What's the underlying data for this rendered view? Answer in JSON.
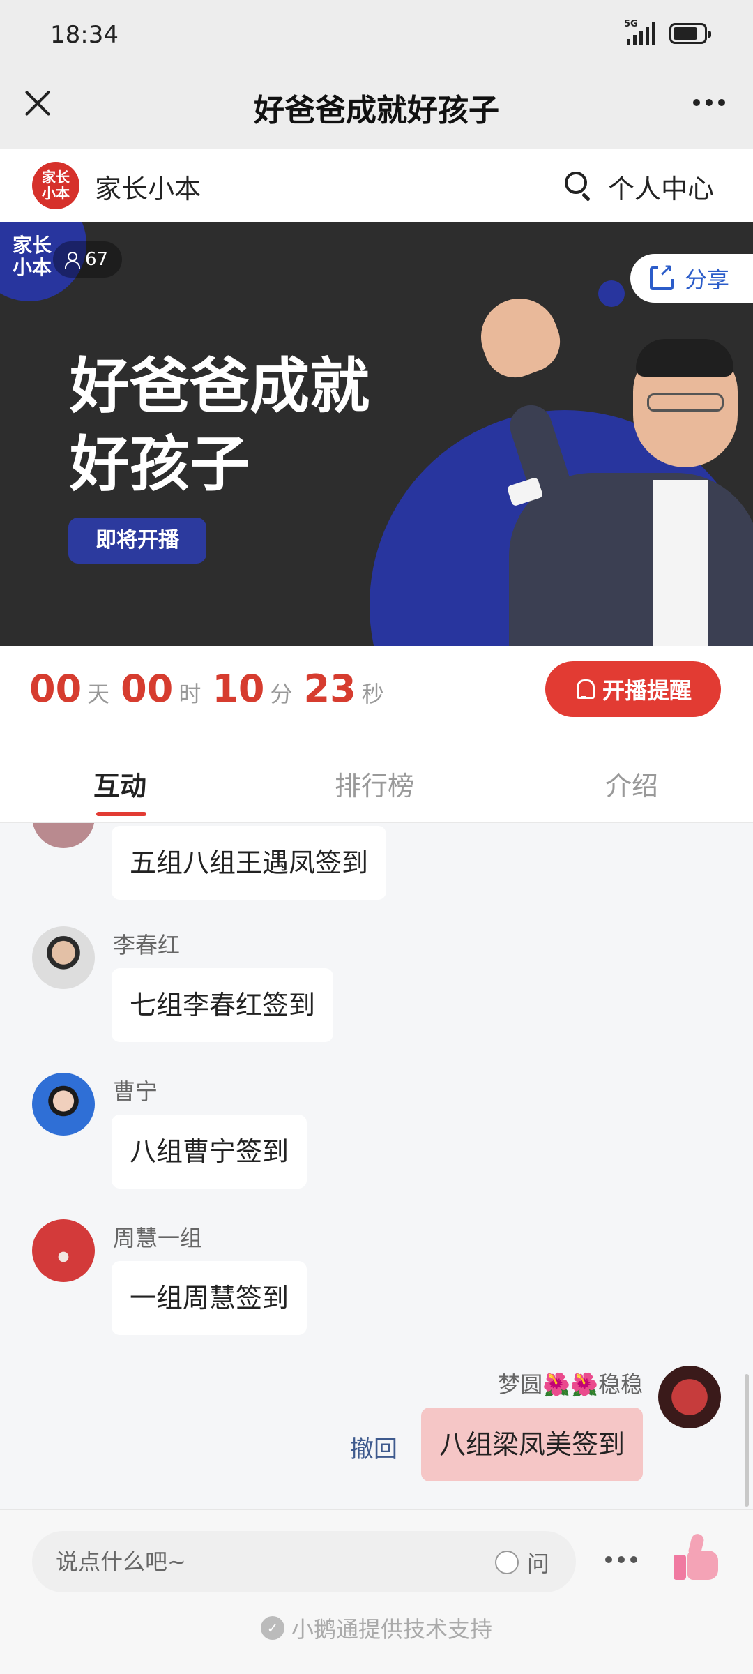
{
  "status_bar": {
    "time": "18:34",
    "network": "5G"
  },
  "nav": {
    "title": "好爸爸成就好孩子"
  },
  "shop": {
    "logo_text": "家长\n小本",
    "name": "家长小本",
    "personal_center": "个人中心"
  },
  "banner": {
    "corner_logo": "家长\n小本",
    "viewer_count": "67",
    "share_label": "分享",
    "title_line1": "好爸爸成就",
    "title_line2": "好孩子",
    "badge": "即将开播"
  },
  "countdown": {
    "days": "00",
    "days_unit": "天",
    "hours": "00",
    "hours_unit": "时",
    "minutes": "10",
    "minutes_unit": "分",
    "seconds": "23",
    "seconds_unit": "秒",
    "remind_label": "开播提醒"
  },
  "tabs": [
    {
      "label": "互动",
      "active": true
    },
    {
      "label": "排行榜",
      "active": false
    },
    {
      "label": "介绍",
      "active": false
    }
  ],
  "messages": [
    {
      "sender": "",
      "text": "五组八组王遇凤签到",
      "mine": false
    },
    {
      "sender": "李春红",
      "text": "七组李春红签到",
      "mine": false
    },
    {
      "sender": "曹宁",
      "text": "八组曹宁签到",
      "mine": false
    },
    {
      "sender": "周慧一组",
      "text": "一组周慧签到",
      "mine": false
    },
    {
      "sender": "梦圆🌺🌺稳稳",
      "text": "八组梁凤美签到",
      "mine": true,
      "retract": "撤回"
    }
  ],
  "input": {
    "placeholder": "说点什么吧~",
    "ask_label": "问"
  },
  "footer": {
    "credit": "小鹅通提供技术支持"
  },
  "colors": {
    "accent_red": "#e23b33",
    "countdown_red": "#d63c2f",
    "banner_blue": "#28359e",
    "banner_bg": "#2d2d2d",
    "my_bubble": "#f5c6c6"
  }
}
